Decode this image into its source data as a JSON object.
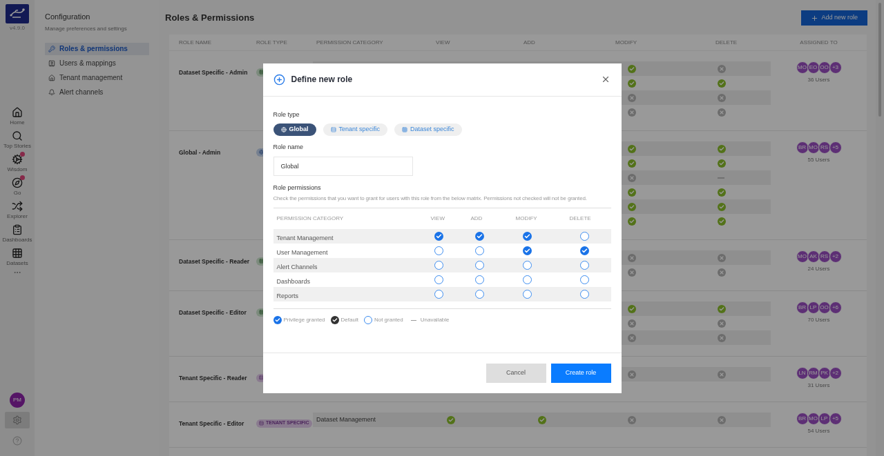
{
  "app": {
    "version": "v4.9.0"
  },
  "nav": [
    {
      "label": "Home",
      "badge": false
    },
    {
      "label": "Top Stories",
      "badge": false
    },
    {
      "label": "Wisdom",
      "badge": true
    },
    {
      "label": "Go",
      "badge": true
    },
    {
      "label": "Explorer",
      "badge": false
    },
    {
      "label": "Dashboards",
      "badge": false
    },
    {
      "label": "Datasets",
      "badge": false
    }
  ],
  "account": {
    "initials": "PM"
  },
  "rail_tools": [
    {
      "kind": "settings",
      "selected": true
    },
    {
      "kind": "help",
      "selected": false
    }
  ],
  "sidebar": {
    "title": "Configuration",
    "subtitle": "Manage preferences and settings",
    "items": [
      {
        "label": "Roles & permissions",
        "selected": true
      },
      {
        "label": "Users & mappings",
        "selected": false
      },
      {
        "label": "Tenant management",
        "selected": false
      },
      {
        "label": "Alert channels",
        "selected": false
      }
    ]
  },
  "page": {
    "title": "Roles & Permissions",
    "add_button": "Add new role"
  },
  "table": {
    "columns": [
      "ROLE NAME",
      "ROLE TYPE",
      "PERMISSION CATEGORY",
      "VIEW",
      "ADD",
      "MODIFY",
      "DELETE",
      "ASSIGNED TO"
    ],
    "roles": [
      {
        "name": "Dataset Specific - Admin",
        "kind": "dataset",
        "permissions": [
          {
            "modify": {
              "kind": "granted"
            },
            "delete": {
              "kind": "denied"
            }
          },
          {
            "modify": {
              "kind": "granted"
            },
            "delete": {
              "kind": "granted"
            }
          },
          {
            "modify": {
              "kind": "denied"
            },
            "delete": {
              "kind": "denied"
            }
          },
          {
            "modify": {
              "kind": "denied"
            },
            "delete": {
              "kind": "denied"
            }
          }
        ],
        "avatars": [
          "MO",
          "EO",
          "OO",
          "+3"
        ],
        "users": "36 Users"
      },
      {
        "name": "Global - Admin",
        "kind": "global",
        "permissions": [
          {
            "modify": {
              "kind": "granted"
            },
            "delete": {
              "kind": "granted"
            }
          },
          {
            "modify": {
              "kind": "granted"
            },
            "delete": {
              "kind": "granted"
            }
          },
          {
            "modify": {
              "kind": "denied"
            },
            "delete": {
              "kind": "unavailable"
            }
          },
          {
            "modify": {
              "kind": "granted"
            },
            "delete": {
              "kind": "granted"
            }
          },
          {
            "modify": {
              "kind": "granted"
            },
            "delete": {
              "kind": "granted"
            }
          },
          {
            "modify": {
              "kind": "granted"
            },
            "delete": {
              "kind": "granted"
            }
          }
        ],
        "avatars": [
          "BR",
          "MO",
          "RS",
          "+5"
        ],
        "users": "55 Users"
      },
      {
        "name": "Dataset Specific - Reader",
        "kind": "dataset",
        "permissions": [
          {
            "modify": {
              "kind": "denied"
            },
            "delete": {
              "kind": "denied"
            }
          },
          {
            "modify": {
              "kind": "denied"
            },
            "delete": {
              "kind": "denied"
            }
          }
        ],
        "avatars": [
          "MO",
          "AK",
          "RS",
          "+2"
        ],
        "users": "24 Users"
      },
      {
        "name": "Dataset Specific - Editor",
        "kind": "dataset",
        "permissions": [
          {
            "modify": {
              "kind": "granted"
            },
            "delete": {
              "kind": "granted"
            }
          },
          {
            "modify": {
              "kind": "denied"
            },
            "delete": {
              "kind": "denied"
            }
          },
          {
            "modify": {
              "kind": "denied"
            },
            "delete": {
              "kind": "denied"
            }
          }
        ],
        "avatars": [
          "BR",
          "LP",
          "OO",
          "+6"
        ],
        "users": "70 Users"
      },
      {
        "name": "Tenant Specific - Reader",
        "kind": "tenant",
        "permissions": [
          {
            "modify": {
              "kind": "denied"
            },
            "delete": {
              "kind": "denied"
            }
          }
        ],
        "avatars": [
          "LN",
          "RM",
          "PK",
          "+2"
        ],
        "users": "31 Users"
      },
      {
        "name": "Tenant Specific - Editor",
        "kind": "tenant",
        "type_label": "TENANT SPECIFIC",
        "permissions": [
          {
            "category": "Dataset Management",
            "view": {
              "kind": "granted"
            },
            "add": {
              "kind": "granted"
            },
            "modify": {
              "kind": "denied"
            },
            "delete": {
              "kind": "denied"
            }
          }
        ],
        "avatars": [
          "BR",
          "MO",
          "LP",
          "+5"
        ],
        "users": "54 Users"
      }
    ]
  },
  "dialog": {
    "title": "Define new role",
    "role_type_label": "Role type",
    "role_types": [
      {
        "label": "Global",
        "selected": true
      },
      {
        "label": "Tenant specific",
        "selected": false
      },
      {
        "label": "Dataset specific",
        "selected": false
      }
    ],
    "role_name_label": "Role name",
    "role_name": "Global",
    "permissions_label": "Role permissions",
    "permissions_hint": "Check the permissions that you want to grant for users with this role from the below matrix. Permissions not checked will not be granted.",
    "columns": [
      "PERMISSION CATEGORY",
      "VIEW",
      "ADD",
      "MODIFY",
      "DELETE"
    ],
    "rows": [
      {
        "label": "Tenant Management",
        "view": true,
        "add": true,
        "modify": true,
        "delete": false
      },
      {
        "label": "User Management",
        "view": false,
        "add": false,
        "modify": true,
        "delete": true
      },
      {
        "label": "Alert Channels",
        "view": false,
        "add": false,
        "modify": false,
        "delete": false
      },
      {
        "label": "Dashboards",
        "view": false,
        "add": false,
        "modify": false,
        "delete": false
      },
      {
        "label": "Reports",
        "view": false,
        "add": false,
        "modify": false,
        "delete": false
      }
    ],
    "legend": [
      {
        "kind": "granted",
        "label": "Privilege granted"
      },
      {
        "kind": "default",
        "label": "Default"
      },
      {
        "kind": "not_granted",
        "label": "Not granted"
      },
      {
        "kind": "unavailable",
        "label": "Unavailable"
      }
    ],
    "cancel": "Cancel",
    "submit": "Create role"
  }
}
